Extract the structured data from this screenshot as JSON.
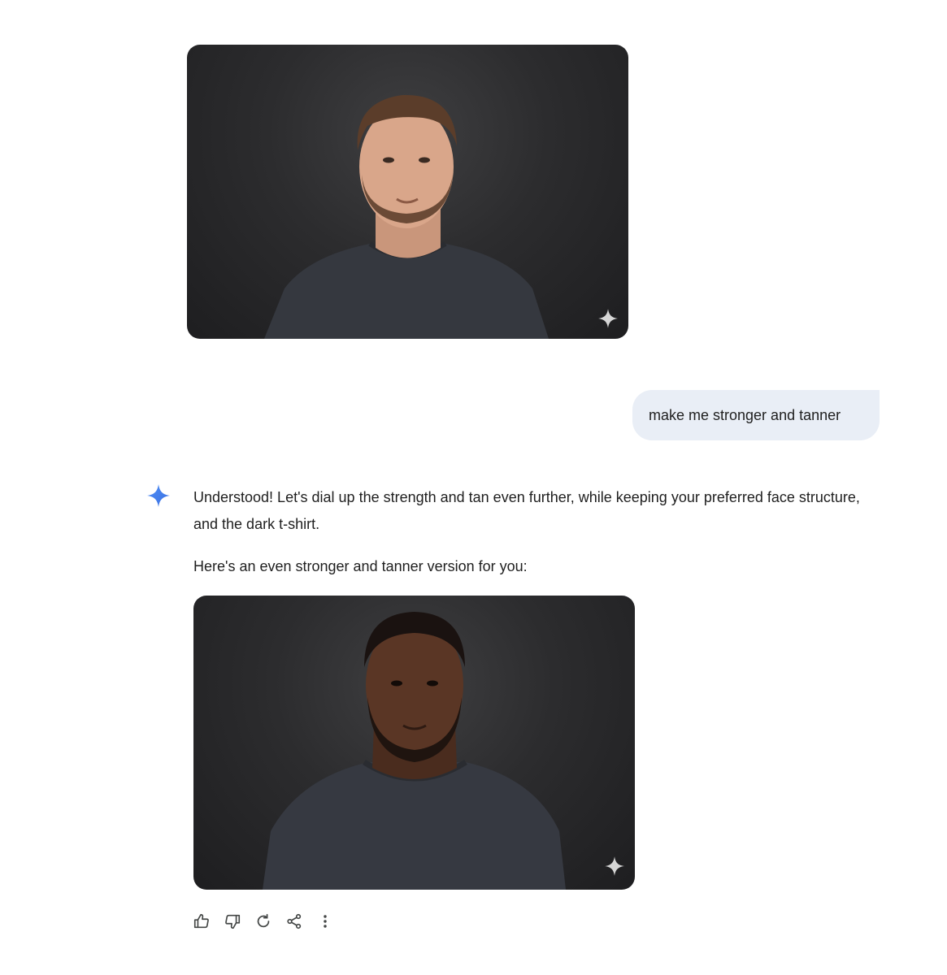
{
  "conversation": {
    "previous_image": {
      "alt": "Portrait of a man with light skin and short brown hair wearing a dark t-shirt",
      "badge_icon": "sparkle-icon"
    },
    "user_message": {
      "text": "make me stronger and tanner"
    },
    "assistant_response": {
      "avatar_icon": "gemini-sparkle-icon",
      "paragraph_1": "Understood! Let's dial up the strength and tan even further, while keeping your preferred face structure, and the dark t-shirt.",
      "paragraph_2": "Here's an even stronger and tanner version for you:",
      "image": {
        "alt": "Portrait of a man with dark skin, short hair and beard wearing a dark t-shirt",
        "badge_icon": "sparkle-icon"
      },
      "actions": [
        {
          "name": "thumbs-up-icon",
          "label": "Good response"
        },
        {
          "name": "thumbs-down-icon",
          "label": "Bad response"
        },
        {
          "name": "regenerate-icon",
          "label": "Redo"
        },
        {
          "name": "share-icon",
          "label": "Share"
        },
        {
          "name": "more-options-icon",
          "label": "More"
        }
      ]
    }
  },
  "colors": {
    "user_bubble": "#e9eef6",
    "gemini_accent": "#4285f4",
    "text": "#1f1f1f",
    "icon": "#444746"
  }
}
